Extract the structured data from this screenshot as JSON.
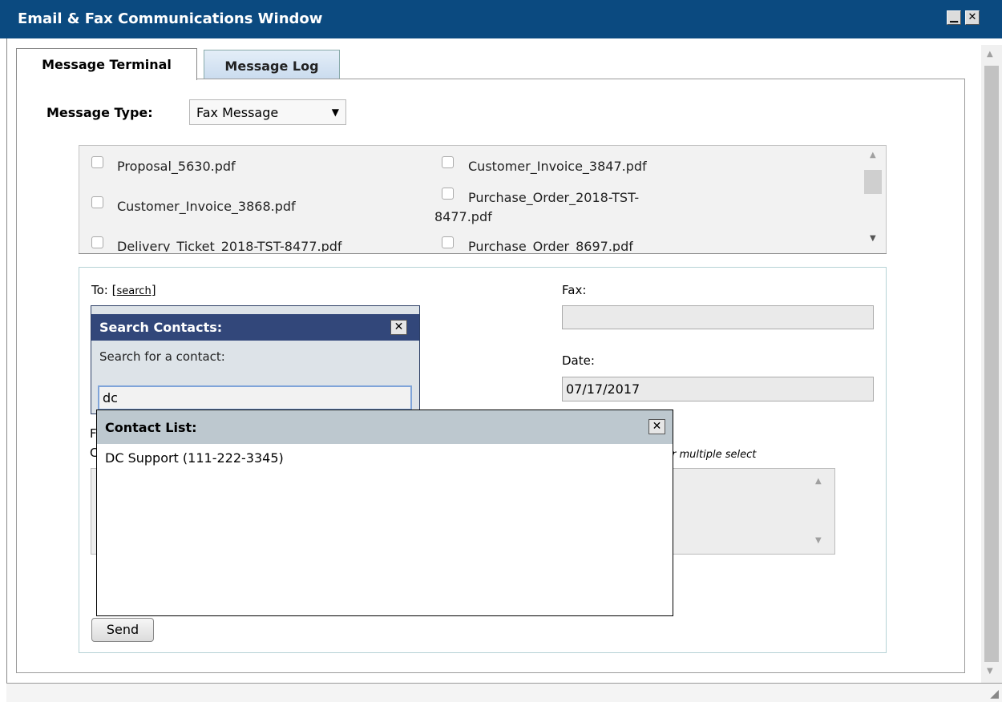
{
  "window": {
    "title": "Email & Fax Communications Window"
  },
  "tabs": [
    {
      "label": "Message Terminal",
      "active": true
    },
    {
      "label": "Message Log",
      "active": false
    }
  ],
  "message_type": {
    "label": "Message Type:",
    "value": "Fax Message"
  },
  "files": [
    {
      "name": "Proposal_5630.pdf",
      "checked": false
    },
    {
      "name": "Customer_Invoice_3847.pdf",
      "checked": false
    },
    {
      "name": "Customer_Invoice_3868.pdf",
      "checked": false
    },
    {
      "name": "Purchase_Order_2018-TST-",
      "name_line2": "8477.pdf",
      "checked": false
    },
    {
      "name": "Delivery_Ticket_2018-TST-8477.pdf",
      "checked": false
    },
    {
      "name": "Purchase_Order_8697.pdf",
      "checked": false
    }
  ],
  "form": {
    "to_label": "To:",
    "search_link": "search",
    "fax_label": "Fax:",
    "fax_value": "",
    "date_label": "Date:",
    "date_value": "07/17/2017",
    "multiple_select_hint": "r multiple select",
    "partial_label_1": "F",
    "partial_label_2": "C",
    "send_label": "Send"
  },
  "search_popup": {
    "title": "Search Contacts:",
    "prompt": "Search for a contact:",
    "query": "dc"
  },
  "contact_list": {
    "title": "Contact List:",
    "items": [
      "DC Support (111-222-3345)"
    ]
  }
}
